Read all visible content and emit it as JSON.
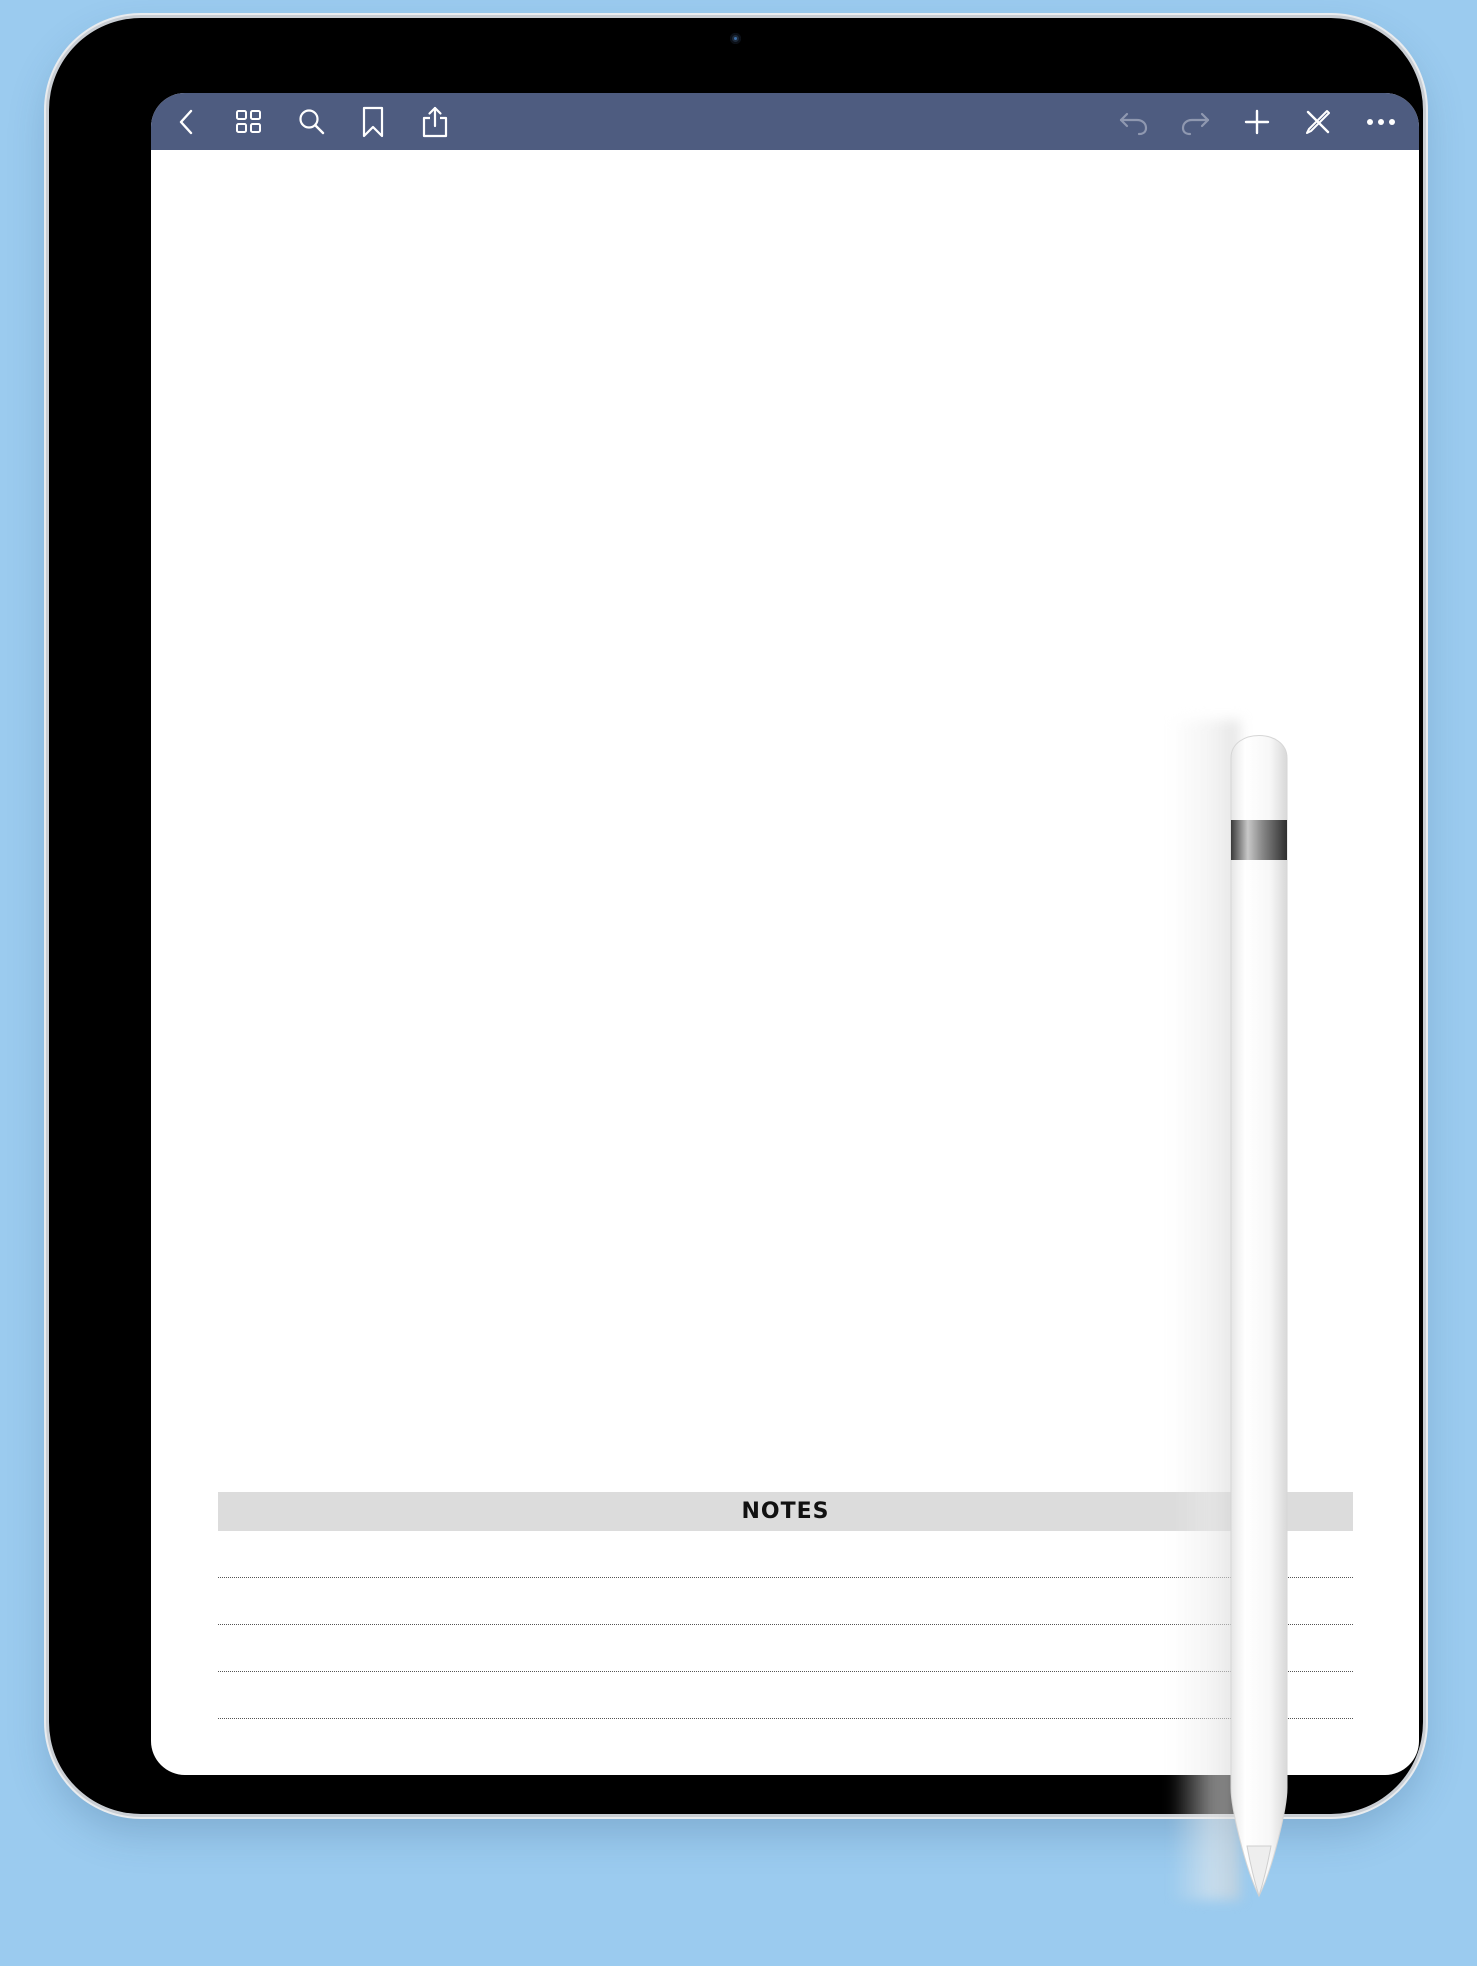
{
  "toolbar": {
    "background_color": "#4e5c80",
    "icons": {
      "back": "chevron-left-icon",
      "grid": "grid-icon",
      "search": "search-icon",
      "bookmark": "bookmark-icon",
      "share": "share-icon",
      "undo": "undo-icon",
      "redo": "redo-icon",
      "add": "plus-icon",
      "tools": "pencil-off-icon",
      "more": "more-icon"
    }
  },
  "page": {
    "notes_title": "NOTES"
  },
  "colors": {
    "background": "#9bcbef",
    "notes_header": "#dcdcdc"
  }
}
